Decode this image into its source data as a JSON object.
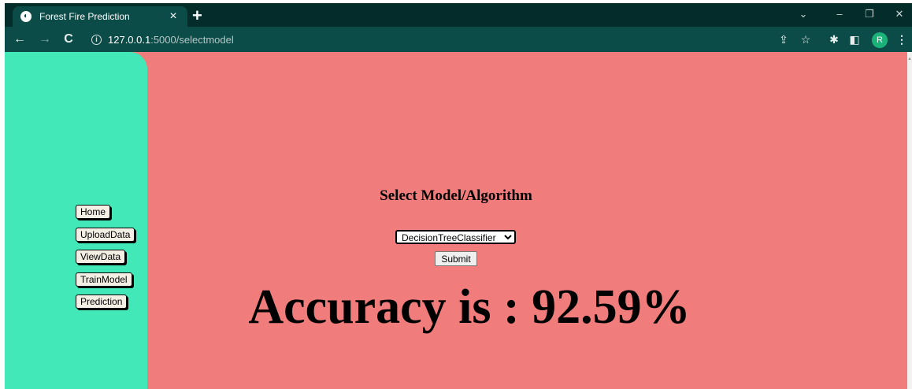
{
  "browser": {
    "tab_title": "Forest Fire Prediction",
    "tab_close": "×",
    "new_tab": "+",
    "url_host": "127.0.0.1",
    "url_path": ":5000/selectmodel",
    "profile_initial": "R",
    "icons": [
      "back-icon",
      "forward-icon",
      "reload-icon",
      "info-icon",
      "share-icon",
      "star-icon",
      "extensions-icon",
      "side-panel-icon",
      "menu-icon"
    ]
  },
  "sidebar": {
    "items": [
      {
        "label": "Home"
      },
      {
        "label": "UploadData"
      },
      {
        "label": "ViewData"
      },
      {
        "label": "TrainModel"
      },
      {
        "label": "Prediction"
      }
    ]
  },
  "main": {
    "heading": "Select Model/Algorithm",
    "selected_model": "DecisionTreeClassifier",
    "submit_label": "Submit",
    "accuracy_text": "Accuracy is : 92.59%"
  },
  "colors": {
    "chrome_dark": "#032c2a",
    "chrome_toolbar": "#0b4b48",
    "page_background": "#f07d7c",
    "sidebar_background": "#42e8b7"
  }
}
